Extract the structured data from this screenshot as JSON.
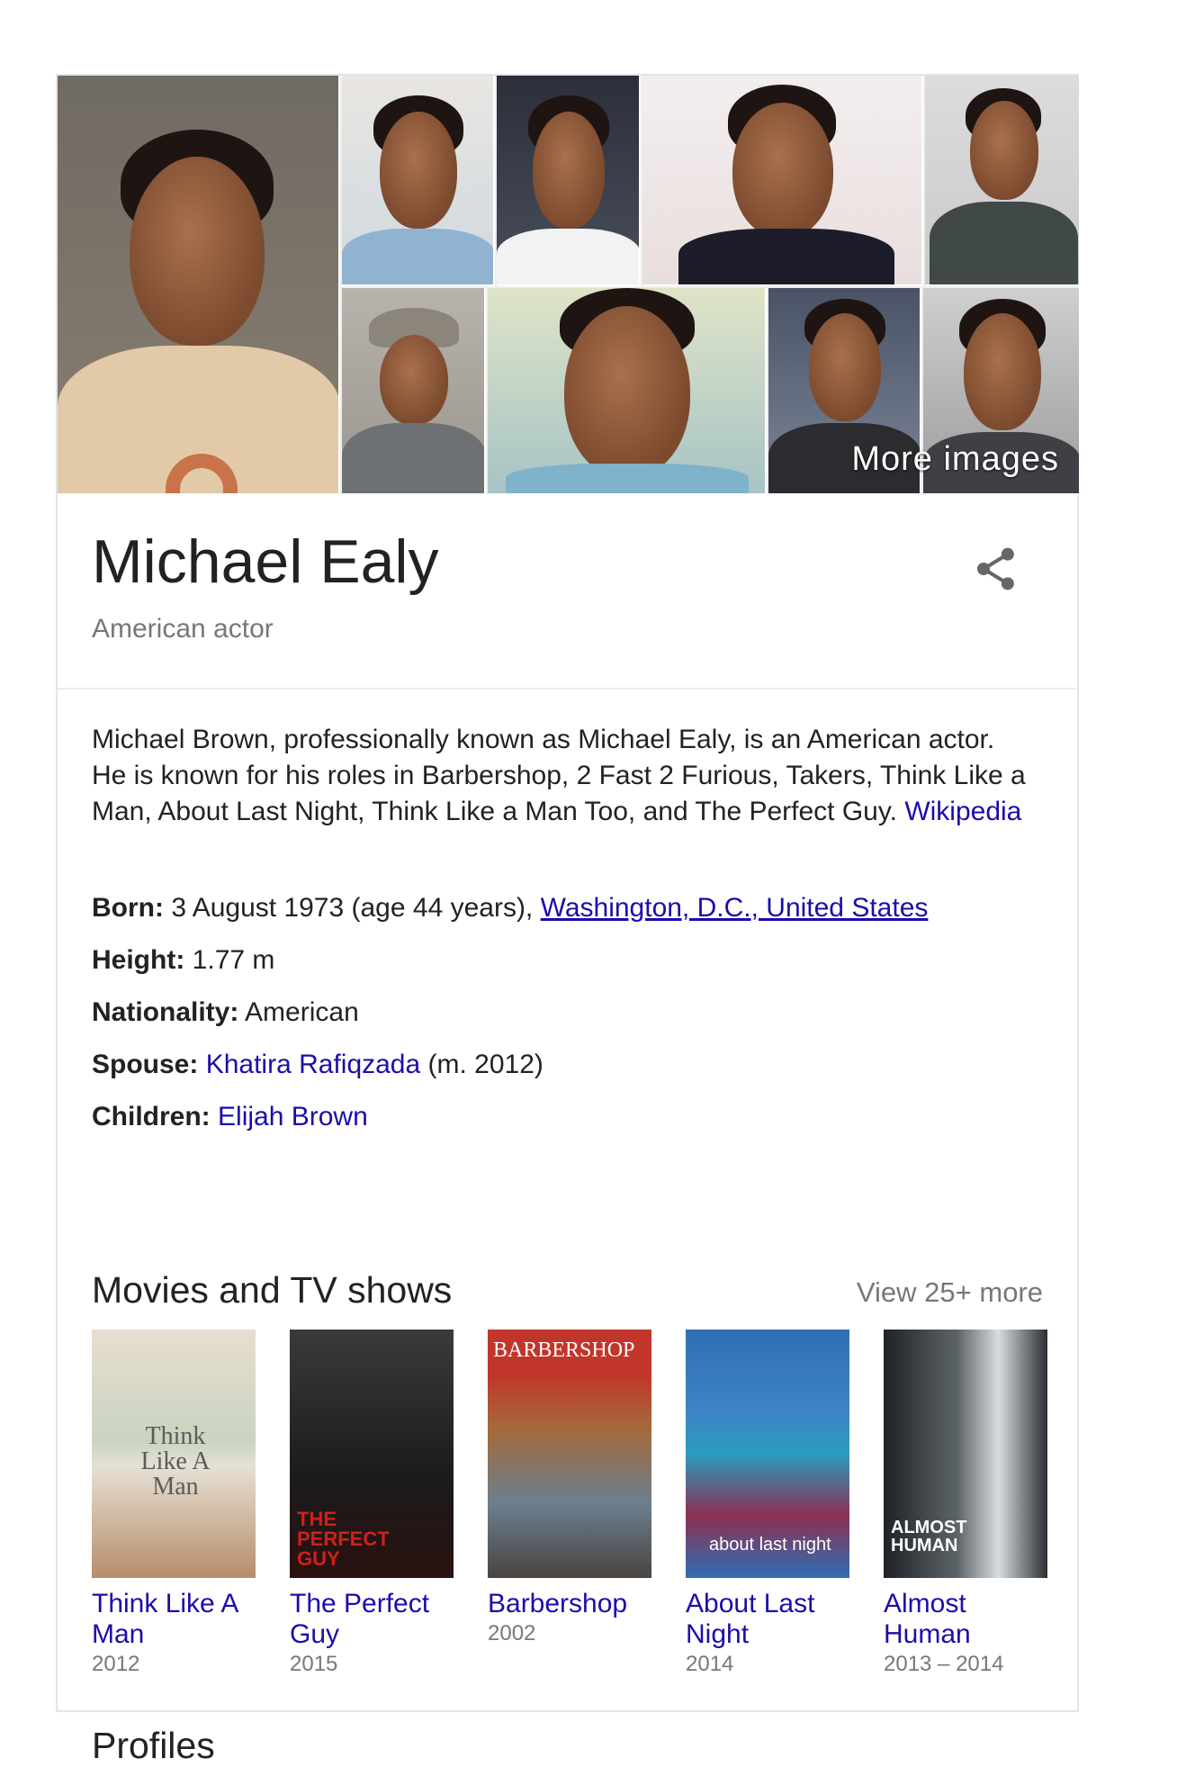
{
  "gallery": {
    "more_images_label": "More images"
  },
  "header": {
    "name": "Michael Ealy",
    "subtitle": "American actor"
  },
  "description": {
    "text": "Michael Brown, professionally known as Michael Ealy, is an American actor. He is known for his roles in Barbershop, 2 Fast 2 Furious, Takers, Think Like a Man, About Last Night, Think Like a Man Too, and The Perfect Guy.",
    "source_link": "Wikipedia"
  },
  "facts": {
    "born": {
      "label": "Born:",
      "text": "3 August 1973 (age 44 years),",
      "link": "Washington, D.C., United States"
    },
    "height": {
      "label": "Height:",
      "value": "1.77 m"
    },
    "nationality": {
      "label": "Nationality:",
      "value": "American"
    },
    "spouse": {
      "label": "Spouse:",
      "link": "Khatira Rafiqzada",
      "suffix": "(m. 2012)"
    },
    "children": {
      "label": "Children:",
      "link": "Elijah Brown"
    }
  },
  "movies": {
    "heading": "Movies and TV shows",
    "view_more": "View 25+ more",
    "items": [
      {
        "title": "Think Like A Man",
        "year": "2012",
        "poster_text": "Think Like A Man"
      },
      {
        "title": "The Perfect Guy",
        "year": "2015",
        "poster_text": "THE PERFECT GUY"
      },
      {
        "title": "Barbershop",
        "year": "2002",
        "poster_text": "BARBERSHOP"
      },
      {
        "title": "About Last Night",
        "year": "2014",
        "poster_text": "about last night"
      },
      {
        "title": "Almost Human",
        "year": "2013 – 2014",
        "poster_text": "ALMOST HUMAN"
      }
    ]
  },
  "profiles": {
    "heading": "Profiles"
  },
  "colors": {
    "link": "#1a0dab",
    "muted": "#777777",
    "text": "#222222"
  },
  "icons": {
    "share": "share-icon"
  }
}
